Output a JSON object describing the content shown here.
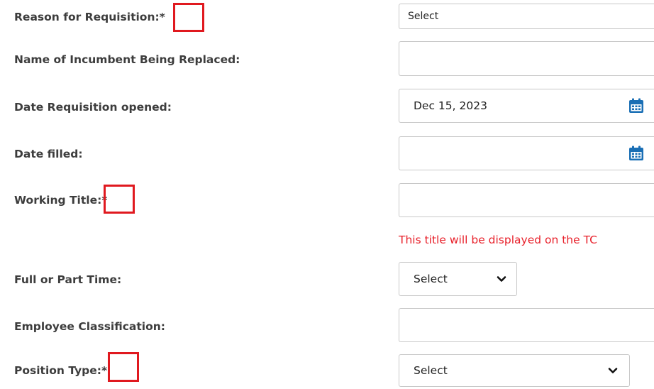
{
  "form": {
    "reason": {
      "label": "Reason for Requisition:*",
      "value": "Select"
    },
    "incumbent": {
      "label": "Name of Incumbent Being Replaced:",
      "value": ""
    },
    "date_opened": {
      "label": "Date Requisition opened:",
      "value": "Dec 15, 2023",
      "icon": "calendar-icon"
    },
    "date_filled": {
      "label": "Date filled:",
      "value": "",
      "icon": "calendar-icon"
    },
    "working_title": {
      "label": "Working Title:*",
      "value": "",
      "hint": "This title will be displayed on the TC"
    },
    "full_part_time": {
      "label": "Full or Part Time:",
      "value": "Select",
      "icon": "chevron-down-icon"
    },
    "employee_classification": {
      "label": "Employee Classification:",
      "value": ""
    },
    "position_type": {
      "label": "Position Type:*",
      "value": "Select",
      "icon": "chevron-down-icon"
    }
  },
  "colors": {
    "highlight": "#e0191f",
    "hint_text": "#e8202a",
    "calendar_icon": "#1a6fb5"
  }
}
